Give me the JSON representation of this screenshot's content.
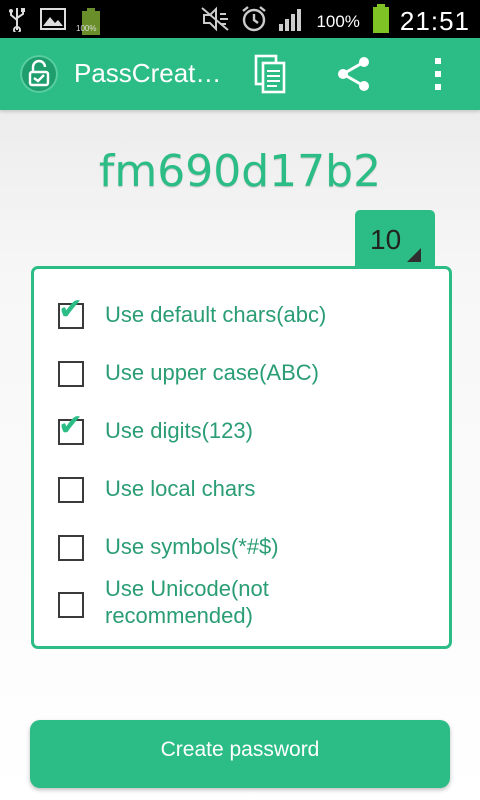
{
  "status_bar": {
    "battery_percent": "100%",
    "time": "21:51",
    "small_battery_label": "100%"
  },
  "app_bar": {
    "title": "PassCreat…",
    "icons": [
      "lock-logo-icon",
      "copy-icon",
      "share-icon",
      "more-vert-icon"
    ]
  },
  "password": {
    "value": "fm690d17b2",
    "length": "10"
  },
  "options": [
    {
      "label": "Use default chars(abc)",
      "checked": true
    },
    {
      "label": "Use upper case(ABC)",
      "checked": false
    },
    {
      "label": "Use digits(123)",
      "checked": true
    },
    {
      "label": "Use local chars",
      "checked": false
    },
    {
      "label": "Use symbols(*#$)",
      "checked": false
    },
    {
      "label": "Use Unicode(not recommended)",
      "checked": false,
      "label_line1": "Use Unicode(not",
      "label_line2": "recommended)"
    }
  ],
  "create_button": {
    "label": "Create password"
  },
  "colors": {
    "accent": "#2cbd86",
    "label_text": "#2a9d74"
  }
}
